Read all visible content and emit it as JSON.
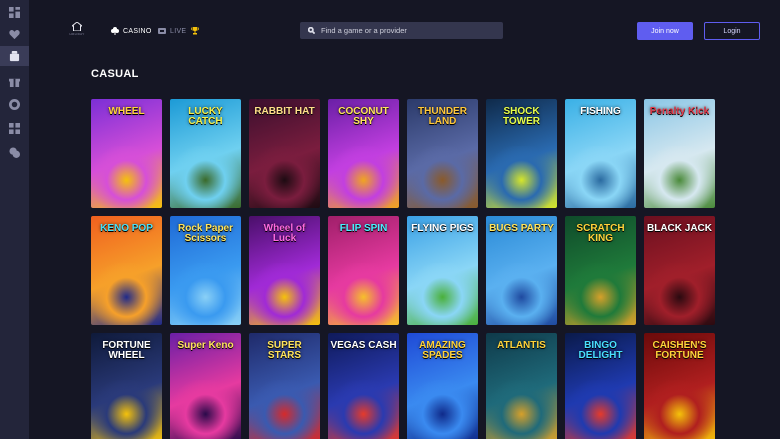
{
  "sidebar": {
    "items": [
      {
        "icon": "dashboard-icon"
      },
      {
        "icon": "heart-icon"
      },
      {
        "icon": "casino-icon",
        "active": true
      },
      {
        "icon": "gift-icon"
      },
      {
        "icon": "chip-icon"
      },
      {
        "icon": "grid-icon"
      },
      {
        "icon": "chat-icon"
      }
    ]
  },
  "header": {
    "logo_text": "HOLIDAY",
    "nav": {
      "casino": "CASINO",
      "live": "LIVE"
    },
    "search_placeholder": "Find a game or a provider",
    "join_label": "Join now",
    "login_label": "Login"
  },
  "section": {
    "title": "CASUAL"
  },
  "games": [
    {
      "name": "WHEEL",
      "colors": [
        "#7b2fd6",
        "#d64fd8",
        "#f5c20a"
      ],
      "title_color": "#ffd33a"
    },
    {
      "name": "LUCKY CATCH",
      "colors": [
        "#1c9ad6",
        "#6fd0f0",
        "#3a6a2a"
      ],
      "title_color": "#f4f04a"
    },
    {
      "name": "RABBIT HAT",
      "colors": [
        "#3b0f2e",
        "#7a1d3e",
        "#1d0b12"
      ],
      "title_color": "#ffe08a"
    },
    {
      "name": "COCONUT SHY",
      "colors": [
        "#6a1fa6",
        "#c23fe0",
        "#f0a51f"
      ],
      "title_color": "#ffe45c"
    },
    {
      "name": "THUNDER LAND",
      "colors": [
        "#2b3a6a",
        "#5a6aa6",
        "#8a5a2a"
      ],
      "title_color": "#ffc83a"
    },
    {
      "name": "SHOCK TOWER",
      "colors": [
        "#0f2a4a",
        "#2a6ab0",
        "#d6e62a"
      ],
      "title_color": "#e8ff4a"
    },
    {
      "name": "FISHING",
      "colors": [
        "#3ab0e6",
        "#8ad6f6",
        "#2a6aa0"
      ],
      "title_color": "#ffffff"
    },
    {
      "name": "Penalty Kick",
      "colors": [
        "#8ac6e6",
        "#d6e8f0",
        "#4a8a3a"
      ],
      "title_color": "#e63a4a"
    },
    {
      "name": "KENO POP",
      "colors": [
        "#f0601f",
        "#f6a02a",
        "#1f2a8a"
      ],
      "title_color": "#4ae0f6"
    },
    {
      "name": "Rock Paper Scissors",
      "colors": [
        "#1f6ad6",
        "#3a9af0",
        "#8ad0f6"
      ],
      "title_color": "#ffe45c"
    },
    {
      "name": "Wheel of Luck",
      "colors": [
        "#4a0f6a",
        "#a02ad6",
        "#f5c20a"
      ],
      "title_color": "#ff6ae0"
    },
    {
      "name": "FLIP SPIN",
      "colors": [
        "#a01f6a",
        "#e63aa0",
        "#f6c02a"
      ],
      "title_color": "#4af0ff"
    },
    {
      "name": "FLYING PIGS",
      "colors": [
        "#3aa0e6",
        "#8ad6f6",
        "#4ab03a"
      ],
      "title_color": "#ffffff"
    },
    {
      "name": "BUGS PARTY",
      "colors": [
        "#2a8ad6",
        "#5ab0f0",
        "#1f4aa0"
      ],
      "title_color": "#ffe45c"
    },
    {
      "name": "SCRATCH KING",
      "colors": [
        "#0f4a2a",
        "#1f7a3a",
        "#d6a02a"
      ],
      "title_color": "#ffd33a"
    },
    {
      "name": "BLACK JACK",
      "colors": [
        "#6a0f1f",
        "#a01f2a",
        "#2a0a10"
      ],
      "title_color": "#ffffff"
    },
    {
      "name": "FORTUNE WHEEL",
      "colors": [
        "#0f1a3a",
        "#2a3a7a",
        "#f5c20a"
      ],
      "title_color": "#ffffff"
    },
    {
      "name": "Super Keno",
      "colors": [
        "#6a1fa6",
        "#e63aa0",
        "#2a0a4a"
      ],
      "title_color": "#ffe45c"
    },
    {
      "name": "SUPER STARS",
      "colors": [
        "#1f2a6a",
        "#3a5ab0",
        "#d62a2a"
      ],
      "title_color": "#ffe45c"
    },
    {
      "name": "VEGAS CASH",
      "colors": [
        "#0f1a5a",
        "#2a3ab0",
        "#e63a2a"
      ],
      "title_color": "#ffffff"
    },
    {
      "name": "AMAZING SPADES",
      "colors": [
        "#1f4ad6",
        "#3a8af0",
        "#0f2a8a"
      ],
      "title_color": "#ffd33a"
    },
    {
      "name": "ATLANTIS",
      "colors": [
        "#0f3a4a",
        "#1f6a7a",
        "#d6a02a"
      ],
      "title_color": "#ffd33a"
    },
    {
      "name": "BINGO DELIGHT",
      "colors": [
        "#0a1a4a",
        "#1f3ab0",
        "#e63a2a"
      ],
      "title_color": "#4ae0ff"
    },
    {
      "name": "CAISHEN'S FORTUNE",
      "colors": [
        "#6a0a0a",
        "#b01f1f",
        "#f5c20a"
      ],
      "title_color": "#ffd33a"
    }
  ]
}
